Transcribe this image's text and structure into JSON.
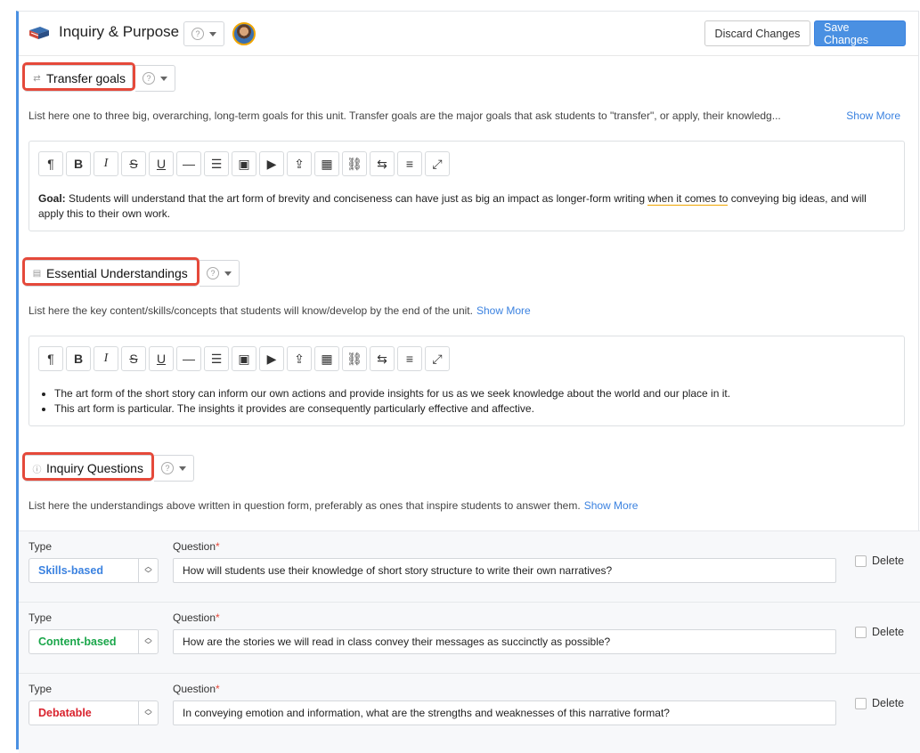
{
  "header": {
    "title": "Inquiry & Purpose",
    "help_symbol": "?",
    "discard_label": "Discard Changes",
    "save_label": "Save Changes"
  },
  "sections": [
    {
      "title": "Transfer goals",
      "icon": "transfer-icon",
      "description": "List here one to three big, overarching, long-term goals for this unit. Transfer goals are the major goals that ask students to \"transfer\", or apply, their knowledg...",
      "show_more": "Show More",
      "content": {
        "bold_prefix": "Goal:",
        "text_part1": " Students will understand that the art form of brevity and conciseness can have just as big an impact as longer-form writing ",
        "text_underlined": "when it comes to",
        "text_part2": " conveying big ideas, and will apply this to their own work."
      }
    },
    {
      "title": "Essential Understandings",
      "icon": "document-icon",
      "description": "List here the key content/skills/concepts that students will know/develop by the end of the unit.",
      "show_more": "Show More",
      "bullets": [
        "The art form of the short story can inform our own actions and provide insights for us as we seek knowledge about the world and our place in it.",
        "This art form is particular. The insights it provides are consequently particularly effective and affective."
      ]
    },
    {
      "title": "Inquiry Questions",
      "icon": "question-icon",
      "description": "List here the understandings above written in question form, preferably as ones that inspire students to answer them.",
      "show_more": "Show More"
    }
  ],
  "toolbar_glyphs": [
    "¶",
    "B",
    "I",
    "S",
    "U",
    "—",
    "☰",
    "▣",
    "▶",
    "⇪",
    "▦",
    "⛓",
    "⇆",
    "≡",
    "⤢"
  ],
  "questions": {
    "type_label": "Type",
    "question_label": "Question",
    "required_mark": "*",
    "delete_label": "Delete",
    "rows": [
      {
        "type": "Skills-based",
        "color": "#3b82e0",
        "question": "How will students use their knowledge of short story structure to write their own narratives?"
      },
      {
        "type": "Content-based",
        "color": "#1aa64a",
        "question": "How are the stories we will read in class convey their messages as succinctly as possible?"
      },
      {
        "type": "Debatable",
        "color": "#d9232e",
        "question": "In conveying emotion and information, what are the strengths and weaknesses of this narrative format?"
      }
    ]
  },
  "colors": {
    "accent": "#4a90e2",
    "highlight": "#e5493a"
  }
}
